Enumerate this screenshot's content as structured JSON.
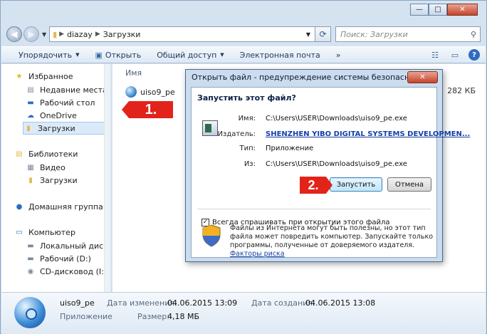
{
  "explorer": {
    "caption": {
      "minimize": "—",
      "maximize": "□",
      "close": "✕"
    },
    "address": {
      "crumbs": [
        "diazay",
        "Загрузки"
      ]
    },
    "search": {
      "placeholder": "Поиск: Загрузки"
    },
    "toolbar": {
      "organize": "Упорядочить",
      "open": "Открыть",
      "share": "Общий доступ",
      "email": "Электронная почта",
      "more": "»"
    },
    "sidebar": {
      "favorites": "Избранное",
      "recent": "Недавние места",
      "desktop": "Рабочий стол",
      "onedrive": "OneDrive",
      "downloads": "Загрузки",
      "libraries": "Библиотеки",
      "video": "Видео",
      "lib_downloads": "Загрузки",
      "homegroup": "Домашняя группа",
      "computer": "Компьютер",
      "local_disk": "Локальный диск (С",
      "desktop_d": "Рабочий (D:)",
      "cd_drive": "CD-дисковод (I:) Le"
    },
    "filelist": {
      "column_name": "Имя",
      "file_name": "uiso9_pe",
      "size_fragment": "282 КБ"
    },
    "details": {
      "name": "uiso9_pe",
      "type": "Приложение",
      "modified_label": "Дата изменения:",
      "modified_value": "04.06.2015 13:09",
      "created_label": "Дата создания:",
      "created_value": "04.06.2015 13:08",
      "size_label": "Размер:",
      "size_value": "4,18 МБ"
    }
  },
  "annotations": {
    "step1": "1.",
    "step2": "2."
  },
  "dialog": {
    "title": "Открыть файл - предупреждение системы безопасности",
    "heading": "Запустить этот файл?",
    "name_label": "Имя:",
    "name_value": "C:\\Users\\USER\\Downloads\\uiso9_pe.exe",
    "publisher_label": "Издатель:",
    "publisher_value": "SHENZHEN YIBO DIGITAL SYSTEMS DEVELOPMEN...",
    "type_label": "Тип:",
    "type_value": "Приложение",
    "from_label": "Из:",
    "from_value": "C:\\Users\\USER\\Downloads\\uiso9_pe.exe",
    "run_button": "Запустить",
    "cancel_button": "Отмена",
    "always_ask": "Всегда спрашивать при открытии этого файла",
    "warning_text": "Файлы из Интернета могут быть полезны, но этот тип файла может повредить компьютер. Запускайте только программы, полученные от доверяемого издателя.",
    "risk_link": "Факторы риска"
  }
}
